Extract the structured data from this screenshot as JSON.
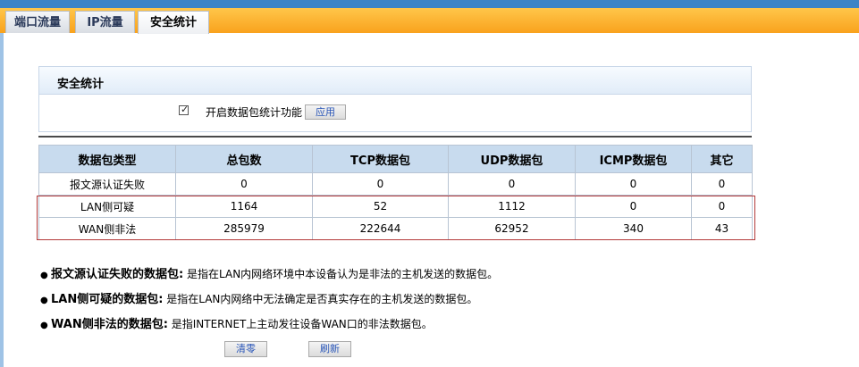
{
  "tabs": [
    {
      "label": "端口流量"
    },
    {
      "label": "IP流量"
    },
    {
      "label": "安全统计"
    }
  ],
  "panel": {
    "title": "安全统计",
    "checkbox_label": "开启数据包统计功能",
    "checkbox_checked": true,
    "apply_label": "应用"
  },
  "table": {
    "headers": [
      "数据包类型",
      "总包数",
      "TCP数据包",
      "UDP数据包",
      "ICMP数据包",
      "其它"
    ],
    "rows": [
      [
        "报文源认证失败",
        "0",
        "0",
        "0",
        "0",
        "0"
      ],
      [
        "LAN侧可疑",
        "1164",
        "52",
        "1112",
        "0",
        "0"
      ],
      [
        "WAN侧非法",
        "285979",
        "222644",
        "62952",
        "340",
        "43"
      ]
    ]
  },
  "notes": [
    {
      "term": "报文源认证失败的数据包:",
      "desc": "是指在LAN内网络环境中本设备认为是非法的主机发送的数据包。"
    },
    {
      "term": "LAN侧可疑的数据包:",
      "desc": "是指在LAN内网络中无法确定是否真实存在的主机发送的数据包。"
    },
    {
      "term": "WAN侧非法的数据包:",
      "desc": "是指INTERNET上主动发往设备WAN口的非法数据包。"
    }
  ],
  "buttons": {
    "clear": "清零",
    "refresh": "刷新"
  },
  "colors": {
    "tabbar": "#f9a21d",
    "header_row": "#c8dbee",
    "highlight_border": "#b33a3a",
    "topbar": "#3d84c6"
  }
}
